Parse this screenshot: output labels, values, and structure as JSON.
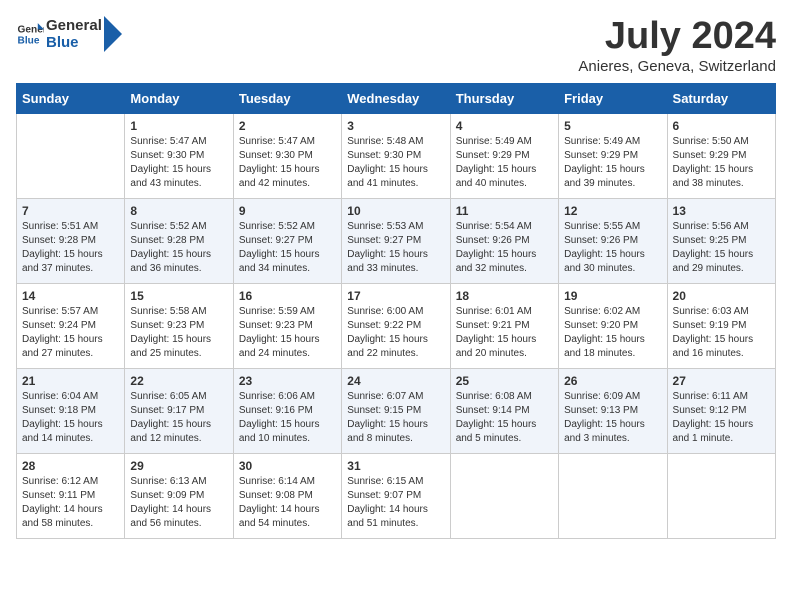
{
  "header": {
    "logo_line1": "General",
    "logo_line2": "Blue",
    "month": "July 2024",
    "location": "Anieres, Geneva, Switzerland"
  },
  "weekdays": [
    "Sunday",
    "Monday",
    "Tuesday",
    "Wednesday",
    "Thursday",
    "Friday",
    "Saturday"
  ],
  "weeks": [
    [
      {
        "day": "",
        "info": ""
      },
      {
        "day": "1",
        "info": "Sunrise: 5:47 AM\nSunset: 9:30 PM\nDaylight: 15 hours\nand 43 minutes."
      },
      {
        "day": "2",
        "info": "Sunrise: 5:47 AM\nSunset: 9:30 PM\nDaylight: 15 hours\nand 42 minutes."
      },
      {
        "day": "3",
        "info": "Sunrise: 5:48 AM\nSunset: 9:30 PM\nDaylight: 15 hours\nand 41 minutes."
      },
      {
        "day": "4",
        "info": "Sunrise: 5:49 AM\nSunset: 9:29 PM\nDaylight: 15 hours\nand 40 minutes."
      },
      {
        "day": "5",
        "info": "Sunrise: 5:49 AM\nSunset: 9:29 PM\nDaylight: 15 hours\nand 39 minutes."
      },
      {
        "day": "6",
        "info": "Sunrise: 5:50 AM\nSunset: 9:29 PM\nDaylight: 15 hours\nand 38 minutes."
      }
    ],
    [
      {
        "day": "7",
        "info": "Sunrise: 5:51 AM\nSunset: 9:28 PM\nDaylight: 15 hours\nand 37 minutes."
      },
      {
        "day": "8",
        "info": "Sunrise: 5:52 AM\nSunset: 9:28 PM\nDaylight: 15 hours\nand 36 minutes."
      },
      {
        "day": "9",
        "info": "Sunrise: 5:52 AM\nSunset: 9:27 PM\nDaylight: 15 hours\nand 34 minutes."
      },
      {
        "day": "10",
        "info": "Sunrise: 5:53 AM\nSunset: 9:27 PM\nDaylight: 15 hours\nand 33 minutes."
      },
      {
        "day": "11",
        "info": "Sunrise: 5:54 AM\nSunset: 9:26 PM\nDaylight: 15 hours\nand 32 minutes."
      },
      {
        "day": "12",
        "info": "Sunrise: 5:55 AM\nSunset: 9:26 PM\nDaylight: 15 hours\nand 30 minutes."
      },
      {
        "day": "13",
        "info": "Sunrise: 5:56 AM\nSunset: 9:25 PM\nDaylight: 15 hours\nand 29 minutes."
      }
    ],
    [
      {
        "day": "14",
        "info": "Sunrise: 5:57 AM\nSunset: 9:24 PM\nDaylight: 15 hours\nand 27 minutes."
      },
      {
        "day": "15",
        "info": "Sunrise: 5:58 AM\nSunset: 9:23 PM\nDaylight: 15 hours\nand 25 minutes."
      },
      {
        "day": "16",
        "info": "Sunrise: 5:59 AM\nSunset: 9:23 PM\nDaylight: 15 hours\nand 24 minutes."
      },
      {
        "day": "17",
        "info": "Sunrise: 6:00 AM\nSunset: 9:22 PM\nDaylight: 15 hours\nand 22 minutes."
      },
      {
        "day": "18",
        "info": "Sunrise: 6:01 AM\nSunset: 9:21 PM\nDaylight: 15 hours\nand 20 minutes."
      },
      {
        "day": "19",
        "info": "Sunrise: 6:02 AM\nSunset: 9:20 PM\nDaylight: 15 hours\nand 18 minutes."
      },
      {
        "day": "20",
        "info": "Sunrise: 6:03 AM\nSunset: 9:19 PM\nDaylight: 15 hours\nand 16 minutes."
      }
    ],
    [
      {
        "day": "21",
        "info": "Sunrise: 6:04 AM\nSunset: 9:18 PM\nDaylight: 15 hours\nand 14 minutes."
      },
      {
        "day": "22",
        "info": "Sunrise: 6:05 AM\nSunset: 9:17 PM\nDaylight: 15 hours\nand 12 minutes."
      },
      {
        "day": "23",
        "info": "Sunrise: 6:06 AM\nSunset: 9:16 PM\nDaylight: 15 hours\nand 10 minutes."
      },
      {
        "day": "24",
        "info": "Sunrise: 6:07 AM\nSunset: 9:15 PM\nDaylight: 15 hours\nand 8 minutes."
      },
      {
        "day": "25",
        "info": "Sunrise: 6:08 AM\nSunset: 9:14 PM\nDaylight: 15 hours\nand 5 minutes."
      },
      {
        "day": "26",
        "info": "Sunrise: 6:09 AM\nSunset: 9:13 PM\nDaylight: 15 hours\nand 3 minutes."
      },
      {
        "day": "27",
        "info": "Sunrise: 6:11 AM\nSunset: 9:12 PM\nDaylight: 15 hours\nand 1 minute."
      }
    ],
    [
      {
        "day": "28",
        "info": "Sunrise: 6:12 AM\nSunset: 9:11 PM\nDaylight: 14 hours\nand 58 minutes."
      },
      {
        "day": "29",
        "info": "Sunrise: 6:13 AM\nSunset: 9:09 PM\nDaylight: 14 hours\nand 56 minutes."
      },
      {
        "day": "30",
        "info": "Sunrise: 6:14 AM\nSunset: 9:08 PM\nDaylight: 14 hours\nand 54 minutes."
      },
      {
        "day": "31",
        "info": "Sunrise: 6:15 AM\nSunset: 9:07 PM\nDaylight: 14 hours\nand 51 minutes."
      },
      {
        "day": "",
        "info": ""
      },
      {
        "day": "",
        "info": ""
      },
      {
        "day": "",
        "info": ""
      }
    ]
  ]
}
